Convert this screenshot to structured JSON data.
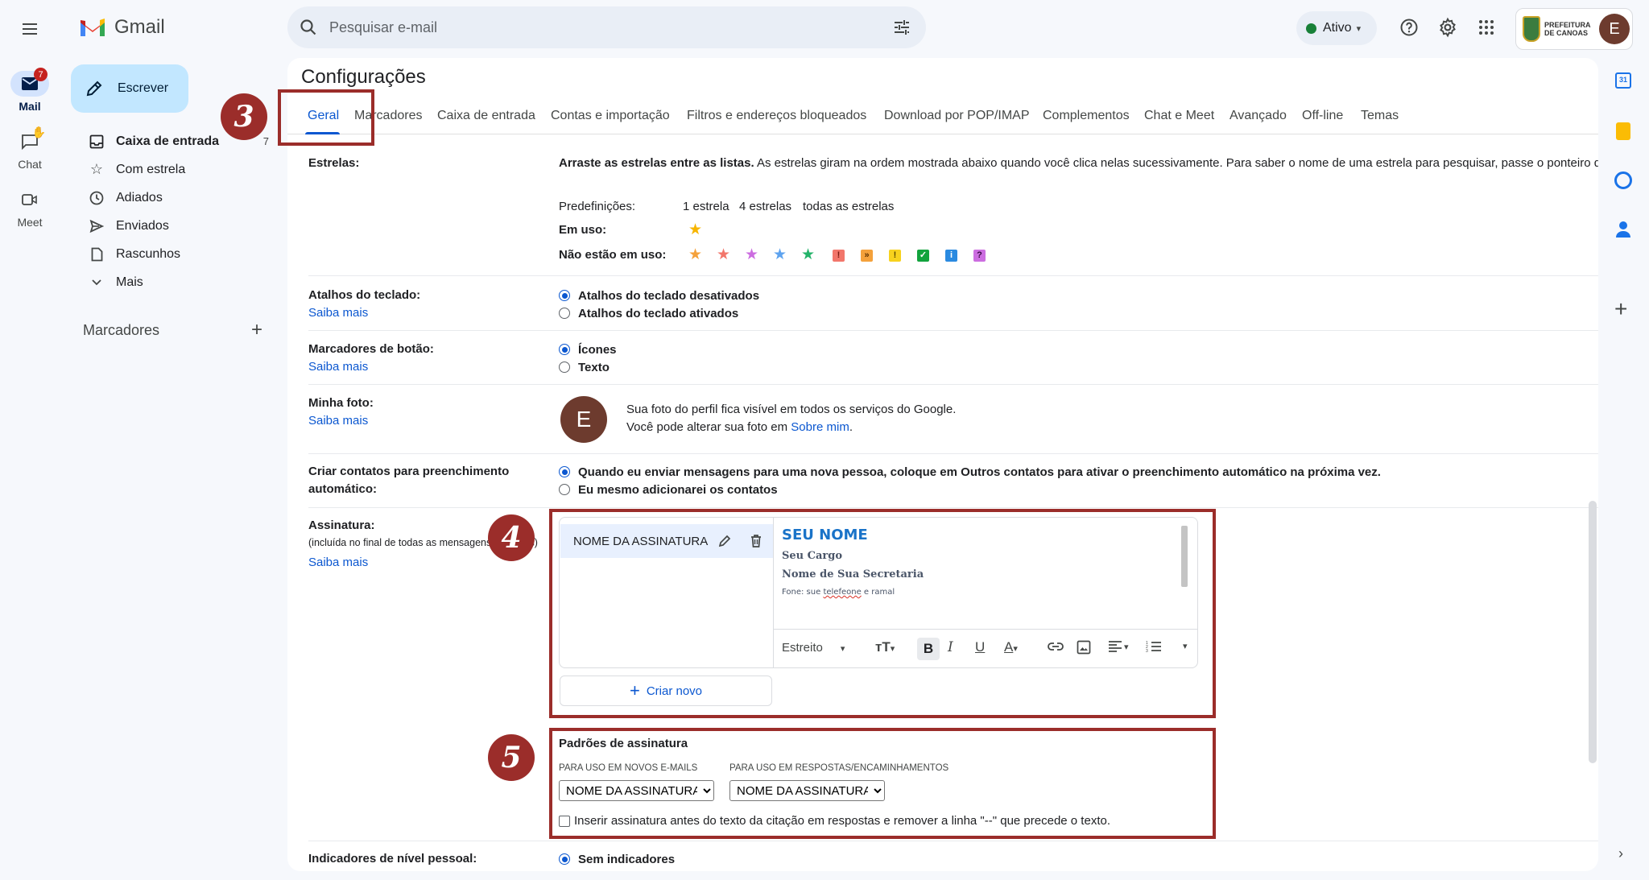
{
  "app": {
    "name": "Gmail"
  },
  "search": {
    "placeholder": "Pesquisar e-mail"
  },
  "status": {
    "label": "Ativo",
    "color": "#188038"
  },
  "account": {
    "avatar_letter": "E",
    "org_logo_text": "PREFEITURA DE CANOAS"
  },
  "rail": {
    "mail_label": "Mail",
    "mail_badge": "7",
    "chat_label": "Chat",
    "meet_label": "Meet"
  },
  "compose": {
    "label": "Escrever"
  },
  "nav": {
    "items": [
      {
        "label": "Caixa de entrada",
        "count": "7",
        "icon": "inbox-icon"
      },
      {
        "label": "Com estrela",
        "icon": "star-outline-icon"
      },
      {
        "label": "Adiados",
        "icon": "clock-icon"
      },
      {
        "label": "Enviados",
        "icon": "send-icon"
      },
      {
        "label": "Rascunhos",
        "icon": "draft-icon"
      },
      {
        "label": "Mais",
        "icon": "chevron-down-icon"
      }
    ],
    "labels_header": "Marcadores"
  },
  "settings": {
    "title": "Configurações",
    "tabs": [
      "Geral",
      "Marcadores",
      "Caixa de entrada",
      "Contas e importação",
      "Filtros e endereços bloqueados",
      "Download por POP/IMAP",
      "Complementos",
      "Chat e Meet",
      "Avançado",
      "Off-line",
      "Temas"
    ],
    "stars": {
      "label": "Estrelas:",
      "desc_bold": "Arraste as estrelas entre as listas.",
      "desc": " As estrelas giram na ordem mostrada abaixo quando você clica nelas sucessivamente. Para saber o nome de uma estrela para pesquisar, passe o ponteiro do mouse sobre a imagem.",
      "presets_label": "Predefinições:",
      "preset_1": "1 estrela",
      "preset_4": "4 estrelas",
      "preset_all": "todas as estrelas",
      "in_use_label": "Em uso:",
      "not_in_use_label": "Não estão em uso:"
    },
    "shortcuts": {
      "label": "Atalhos do teclado:",
      "learn": "Saiba mais",
      "opt_off": "Atalhos do teclado desativados",
      "opt_on": "Atalhos do teclado ativados"
    },
    "button_labels": {
      "label": "Marcadores de botão:",
      "learn": "Saiba mais",
      "opt_icons": "Ícones",
      "opt_text": "Texto"
    },
    "photo": {
      "label": "Minha foto:",
      "learn": "Saiba mais",
      "avatar": "E",
      "line1": "Sua foto do perfil fica visível em todos os serviços do Google.",
      "line2_prefix": "Você pode alterar sua foto em ",
      "line2_link": "Sobre mim",
      "line2_suffix": "."
    },
    "contacts": {
      "label_1": "Criar contatos para preenchimento",
      "label_2": "automático:",
      "opt_auto": "Quando eu enviar mensagens para uma nova pessoa, coloque em Outros contatos para ativar o preenchimento automático na próxima vez.",
      "opt_manual": "Eu mesmo adicionarei os contatos"
    },
    "signature": {
      "label": "Assinatura:",
      "sub": "(incluída no final de todas as mensagens enviadas)",
      "learn": "Saiba mais",
      "name": "NOME DA ASSINATURA",
      "editor": {
        "name": "SEU NOME",
        "cargo": "Seu Cargo",
        "secretaria": "Nome de Sua Secretaria",
        "phone_prefix": "Fone: sue ",
        "phone_word": "telefeone",
        "phone_suffix": " e ramal",
        "font": "Estreito"
      },
      "create_new": "Criar novo"
    },
    "defaults": {
      "title": "Padrões de assinatura",
      "new_label": "PARA USO EM NOVOS E-MAILS",
      "reply_label": "PARA USO EM RESPOSTAS/ENCAMINHAMENTOS",
      "new_value": "NOME DA ASSINATURA",
      "reply_value": "NOME DA ASSINATURA",
      "insert_before": "Inserir assinatura antes do texto da citação em respostas e remover a linha \"--\" que precede o texto."
    },
    "personal": {
      "label": "Indicadores de nível pessoal:",
      "opt_none": "Sem indicadores"
    }
  },
  "annotations": {
    "step3": "3",
    "step4": "4",
    "step5": "5"
  },
  "colors": {
    "annotation": "#9b2d2a",
    "accent": "#0b57d0",
    "signature_blue": "#1a73c8"
  }
}
